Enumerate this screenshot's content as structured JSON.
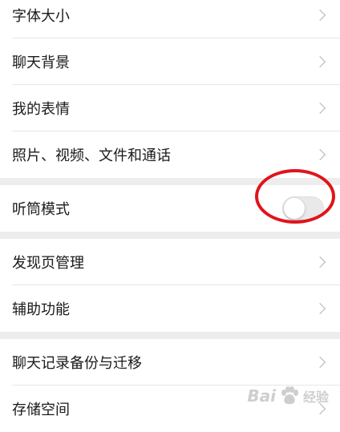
{
  "group1": [
    {
      "label": "字体大小"
    },
    {
      "label": "聊天背景"
    },
    {
      "label": "我的表情"
    },
    {
      "label": "照片、视频、文件和通话"
    }
  ],
  "group2": {
    "label": "听筒模式",
    "toggle_on": false
  },
  "group3": [
    {
      "label": "发现页管理"
    },
    {
      "label": "辅助功能"
    }
  ],
  "group4": [
    {
      "label": "聊天记录备份与迁移"
    },
    {
      "label": "存储空间"
    }
  ],
  "watermark": {
    "latin": "Bai",
    "chinese": "经验"
  },
  "colors": {
    "background": "#ededed",
    "annotation": "#e0141c"
  }
}
